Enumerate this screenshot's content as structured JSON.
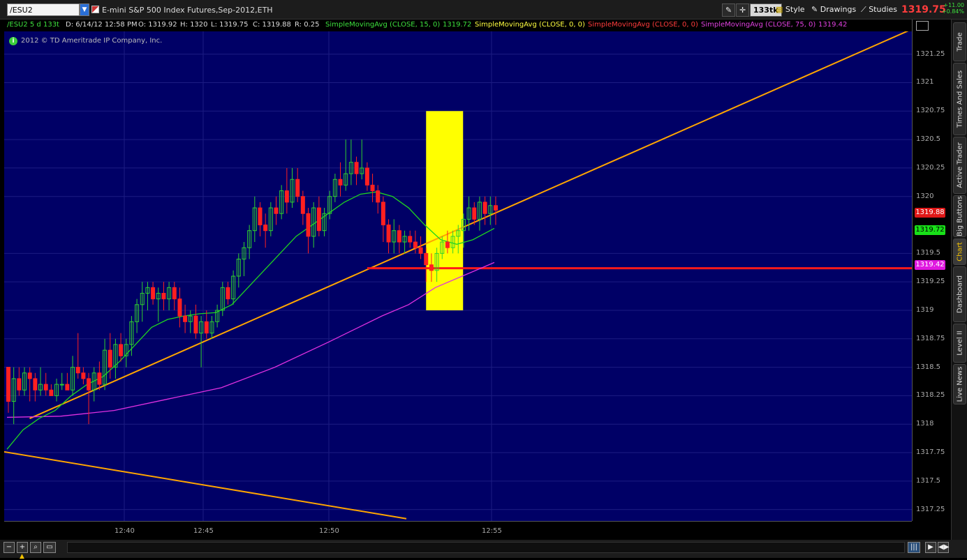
{
  "toolbar": {
    "symbol": "/ESU2",
    "instrument_name": "E-mini S&P 500 Index Futures,Sep-2012,ETH",
    "aggregation_label": "133tk",
    "style_label": "Style",
    "drawings_label": "Drawings",
    "studies_label": "Studies",
    "last_price": "1319.75",
    "net_change": "+11.00",
    "pct_change": "+0.84%"
  },
  "header": {
    "symbol_period": "/ESU2 5 d 133t",
    "date": "D: 6/14/12 12:58 PM",
    "open": "O: 1319.92",
    "high": "H: 1320",
    "low": "L: 1319.75",
    "close": "C: 1319.88",
    "range": "R: 0.25",
    "study1": "SimpleMovingAvg (CLOSE, 15, 0)",
    "study1_value": "1319.72",
    "study2": "SimpleMovingAvg (CLOSE, 0, 0)",
    "study3": "SimpleMovingAvg (CLOSE, 0, 0)",
    "study4": "SimpleMovingAvg (CLOSE, 75, 0)",
    "study4_value": "1319.42"
  },
  "copyright": "2012 © TD Ameritrade IP Company, Inc.",
  "colors": {
    "background": "#000066",
    "up": "#2fd12f",
    "down": "#ff2020",
    "sma15": "#1fd41f",
    "sma75": "#e030e0",
    "trendline": "#ffa500",
    "support": "#ff1a1a",
    "highlight": "#ffff00"
  },
  "y_ticks": [
    "1321.25",
    "1321",
    "1320.75",
    "1320.5",
    "1320.25",
    "1320",
    "1319.5",
    "1319.25",
    "1319",
    "1318.75",
    "1318.5",
    "1318.25",
    "1318",
    "1317.75",
    "1317.5",
    "1317.25"
  ],
  "price_badges": {
    "last": "1319.88",
    "sma15": "1319.72",
    "sma75": "1319.42"
  },
  "x_ticks": [
    "12:40",
    "12:45",
    "12:50",
    "12:55"
  ],
  "side_tabs": [
    "Trade",
    "Times And Sales",
    "Active Trader",
    "Big Buttons",
    "Chart",
    "Dashboard",
    "Level II",
    "Live News"
  ],
  "active_tab": "Chart",
  "chart_data": {
    "type": "candlestick",
    "ylim": [
      1317.15,
      1321.45
    ],
    "x_count": 96,
    "candles": [
      [
        0,
        1318.5,
        1318.5,
        1318.1,
        1318.2
      ],
      [
        1,
        1318.2,
        1318.5,
        1318.0,
        1318.4
      ],
      [
        2,
        1318.4,
        1318.5,
        1318.25,
        1318.3
      ],
      [
        3,
        1318.3,
        1318.5,
        1318.25,
        1318.45
      ],
      [
        4,
        1318.45,
        1318.5,
        1318.2,
        1318.4
      ],
      [
        5,
        1318.4,
        1318.45,
        1318.2,
        1318.3
      ],
      [
        6,
        1318.3,
        1318.5,
        1318.25,
        1318.35
      ],
      [
        7,
        1318.35,
        1318.45,
        1318.25,
        1318.3
      ],
      [
        8,
        1318.3,
        1318.35,
        1318.25,
        1318.25
      ],
      [
        9,
        1318.25,
        1318.4,
        1318.2,
        1318.35
      ],
      [
        10,
        1318.35,
        1318.45,
        1318.3,
        1318.35
      ],
      [
        11,
        1318.35,
        1318.45,
        1318.3,
        1318.3
      ],
      [
        12,
        1318.3,
        1318.6,
        1318.25,
        1318.5
      ],
      [
        13,
        1318.5,
        1318.8,
        1318.4,
        1318.45
      ],
      [
        14,
        1318.45,
        1318.5,
        1318.35,
        1318.4
      ],
      [
        15,
        1318.4,
        1318.45,
        1318.0,
        1318.3
      ],
      [
        16,
        1318.3,
        1318.5,
        1318.2,
        1318.45
      ],
      [
        17,
        1318.45,
        1318.55,
        1318.3,
        1318.35
      ],
      [
        18,
        1318.35,
        1318.75,
        1318.3,
        1318.65
      ],
      [
        19,
        1318.65,
        1318.8,
        1318.4,
        1318.5
      ],
      [
        20,
        1318.5,
        1318.75,
        1318.4,
        1318.7
      ],
      [
        21,
        1318.7,
        1318.8,
        1318.55,
        1318.6
      ],
      [
        22,
        1318.6,
        1318.75,
        1318.5,
        1318.7
      ],
      [
        23,
        1318.7,
        1318.95,
        1318.6,
        1318.9
      ],
      [
        24,
        1318.9,
        1319.1,
        1318.8,
        1319.05
      ],
      [
        25,
        1319.05,
        1319.25,
        1318.9,
        1319.15
      ],
      [
        26,
        1319.15,
        1319.25,
        1319.0,
        1319.2
      ],
      [
        27,
        1319.2,
        1319.25,
        1319.05,
        1319.1
      ],
      [
        28,
        1319.1,
        1319.2,
        1318.9,
        1319.15
      ],
      [
        29,
        1319.15,
        1319.25,
        1319.0,
        1319.1
      ],
      [
        30,
        1319.1,
        1319.25,
        1319.0,
        1319.2
      ],
      [
        31,
        1319.2,
        1319.25,
        1319.0,
        1319.1
      ],
      [
        32,
        1319.1,
        1319.2,
        1318.85,
        1318.95
      ],
      [
        33,
        1318.95,
        1319.05,
        1318.8,
        1318.9
      ],
      [
        34,
        1318.9,
        1319.0,
        1318.8,
        1318.95
      ],
      [
        35,
        1318.95,
        1319.05,
        1318.75,
        1318.8
      ],
      [
        36,
        1318.8,
        1318.95,
        1318.5,
        1318.9
      ],
      [
        37,
        1318.9,
        1319.0,
        1318.75,
        1318.8
      ],
      [
        38,
        1318.8,
        1318.95,
        1318.75,
        1318.9
      ],
      [
        39,
        1318.9,
        1319.05,
        1318.85,
        1319.0
      ],
      [
        40,
        1319.0,
        1319.25,
        1318.95,
        1319.2
      ],
      [
        41,
        1319.2,
        1319.25,
        1319.05,
        1319.1
      ],
      [
        42,
        1319.1,
        1319.35,
        1319.05,
        1319.3
      ],
      [
        43,
        1319.3,
        1319.5,
        1319.2,
        1319.45
      ],
      [
        44,
        1319.45,
        1319.6,
        1319.3,
        1319.55
      ],
      [
        45,
        1319.55,
        1319.75,
        1319.45,
        1319.7
      ],
      [
        46,
        1319.7,
        1320.0,
        1319.6,
        1319.9
      ],
      [
        47,
        1319.9,
        1319.95,
        1319.65,
        1319.75
      ],
      [
        48,
        1319.75,
        1319.85,
        1319.55,
        1319.7
      ],
      [
        49,
        1319.7,
        1319.95,
        1319.65,
        1319.9
      ],
      [
        50,
        1319.9,
        1320.0,
        1319.75,
        1319.85
      ],
      [
        51,
        1319.85,
        1320.1,
        1319.8,
        1320.05
      ],
      [
        52,
        1320.05,
        1320.25,
        1319.85,
        1319.95
      ],
      [
        53,
        1319.95,
        1320.25,
        1319.9,
        1320.15
      ],
      [
        54,
        1320.15,
        1320.25,
        1319.95,
        1320.0
      ],
      [
        55,
        1320.0,
        1320.05,
        1319.75,
        1319.85
      ],
      [
        56,
        1319.85,
        1319.9,
        1319.5,
        1319.65
      ],
      [
        57,
        1319.65,
        1319.95,
        1319.55,
        1319.9
      ],
      [
        58,
        1319.9,
        1320.0,
        1319.65,
        1319.7
      ],
      [
        59,
        1319.7,
        1319.9,
        1319.65,
        1319.85
      ],
      [
        60,
        1319.85,
        1320.05,
        1319.8,
        1320.0
      ],
      [
        61,
        1320.0,
        1320.2,
        1319.95,
        1320.15
      ],
      [
        62,
        1320.15,
        1320.3,
        1320.0,
        1320.1
      ],
      [
        63,
        1320.1,
        1320.5,
        1320.05,
        1320.2
      ],
      [
        64,
        1320.2,
        1320.5,
        1320.1,
        1320.3
      ],
      [
        65,
        1320.3,
        1320.35,
        1320.1,
        1320.2
      ],
      [
        66,
        1320.2,
        1320.5,
        1320.15,
        1320.25
      ],
      [
        67,
        1320.25,
        1320.3,
        1320.05,
        1320.1
      ],
      [
        68,
        1320.1,
        1320.2,
        1319.95,
        1320.05
      ],
      [
        69,
        1320.05,
        1320.1,
        1319.85,
        1319.95
      ],
      [
        70,
        1319.95,
        1320.0,
        1319.6,
        1319.75
      ],
      [
        71,
        1319.75,
        1319.8,
        1319.5,
        1319.6
      ],
      [
        72,
        1319.6,
        1319.8,
        1319.5,
        1319.7
      ],
      [
        73,
        1319.7,
        1319.75,
        1319.5,
        1319.6
      ],
      [
        74,
        1319.6,
        1319.7,
        1319.5,
        1319.65
      ],
      [
        75,
        1319.65,
        1319.7,
        1319.55,
        1319.6
      ],
      [
        76,
        1319.6,
        1319.7,
        1319.5,
        1319.55
      ],
      [
        77,
        1319.55,
        1319.65,
        1319.45,
        1319.5
      ],
      [
        78,
        1319.5,
        1319.55,
        1319.25,
        1319.4
      ],
      [
        79,
        1319.4,
        1319.5,
        1319.25,
        1319.35
      ],
      [
        80,
        1319.35,
        1319.55,
        1319.25,
        1319.5
      ],
      [
        81,
        1319.5,
        1319.65,
        1319.45,
        1319.6
      ],
      [
        82,
        1319.6,
        1319.7,
        1319.5,
        1319.55
      ],
      [
        83,
        1319.55,
        1319.7,
        1319.5,
        1319.65
      ],
      [
        84,
        1319.65,
        1319.75,
        1319.5,
        1319.7
      ],
      [
        85,
        1319.7,
        1319.85,
        1319.55,
        1319.8
      ],
      [
        86,
        1319.8,
        1320.0,
        1319.7,
        1319.9
      ],
      [
        87,
        1319.9,
        1319.95,
        1319.75,
        1319.8
      ],
      [
        88,
        1319.8,
        1320.0,
        1319.7,
        1319.95
      ],
      [
        89,
        1319.95,
        1320.0,
        1319.75,
        1319.85
      ],
      [
        90,
        1319.85,
        1320.0,
        1319.75,
        1319.92
      ],
      [
        91,
        1319.92,
        1320.0,
        1319.75,
        1319.88
      ]
    ],
    "sma15": [
      [
        0,
        1317.78
      ],
      [
        3,
        1317.95
      ],
      [
        6,
        1318.05
      ],
      [
        9,
        1318.12
      ],
      [
        12,
        1318.25
      ],
      [
        15,
        1318.35
      ],
      [
        18,
        1318.42
      ],
      [
        21,
        1318.55
      ],
      [
        24,
        1318.7
      ],
      [
        27,
        1318.85
      ],
      [
        30,
        1318.92
      ],
      [
        33,
        1318.95
      ],
      [
        36,
        1318.97
      ],
      [
        39,
        1318.98
      ],
      [
        42,
        1319.05
      ],
      [
        45,
        1319.2
      ],
      [
        48,
        1319.35
      ],
      [
        51,
        1319.5
      ],
      [
        54,
        1319.65
      ],
      [
        57,
        1319.75
      ],
      [
        60,
        1319.85
      ],
      [
        63,
        1319.95
      ],
      [
        66,
        1320.02
      ],
      [
        69,
        1320.04
      ],
      [
        72,
        1320.0
      ],
      [
        75,
        1319.9
      ],
      [
        78,
        1319.75
      ],
      [
        81,
        1319.62
      ],
      [
        84,
        1319.58
      ],
      [
        87,
        1319.62
      ],
      [
        91,
        1319.72
      ]
    ],
    "sma75": [
      [
        0,
        1318.06
      ],
      [
        10,
        1318.07
      ],
      [
        20,
        1318.12
      ],
      [
        30,
        1318.22
      ],
      [
        40,
        1318.32
      ],
      [
        50,
        1318.5
      ],
      [
        60,
        1318.72
      ],
      [
        70,
        1318.95
      ],
      [
        75,
        1319.05
      ],
      [
        80,
        1319.2
      ],
      [
        85,
        1319.3
      ],
      [
        91,
        1319.42
      ]
    ],
    "trendlines": [
      {
        "x1": -1,
        "y1": 1317.76,
        "x2": 88,
        "y2": 1317.17
      },
      {
        "x1": 5,
        "y1": 1318.05,
        "x2": 200,
        "y2": 1321.48
      }
    ],
    "support_line": {
      "y": 1319.37,
      "x1": 42
    },
    "highlight_box": {
      "x1": 98.5,
      "x2": 107,
      "y1": 1319.0,
      "y2": 1320.75
    }
  }
}
